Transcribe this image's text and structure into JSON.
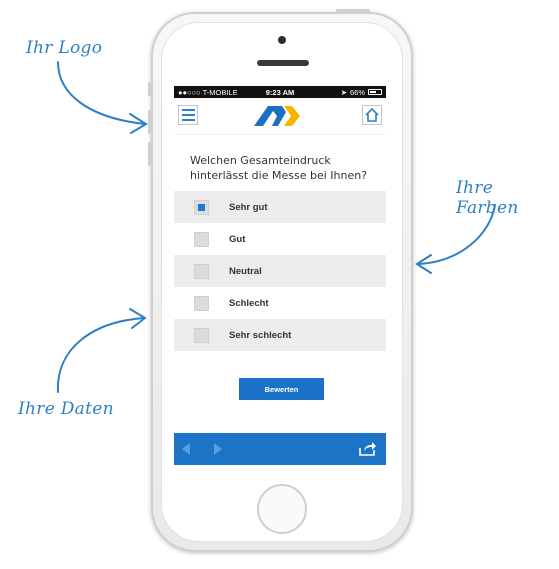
{
  "annotations": {
    "logo": "Ihr Logo",
    "colors": "Ihre Farben",
    "data": "Ihre Daten"
  },
  "statusbar": {
    "carrier": "●●○○○ T-MOBILE",
    "time": "9:23 AM",
    "battery": "66%"
  },
  "appbar": {
    "menu_icon": "hamburger-icon",
    "home_icon": "home-icon",
    "logo_colors": [
      "#1e6fc4",
      "#f2b600"
    ]
  },
  "survey": {
    "question": "Welchen Gesamteindruck hinterlässt die Messe bei Ihnen?",
    "options": [
      {
        "label": "Sehr gut",
        "checked": true
      },
      {
        "label": "Gut",
        "checked": false
      },
      {
        "label": "Neutral",
        "checked": false
      },
      {
        "label": "Schlecht",
        "checked": false
      },
      {
        "label": "Sehr schlecht",
        "checked": false
      }
    ],
    "submit_label": "Bewerten"
  },
  "bottombar": {
    "back_icon": "arrow-left-icon",
    "forward_icon": "arrow-right-icon",
    "share_icon": "share-icon"
  },
  "colors": {
    "accent": "#1c74c7",
    "annotation": "#2f7fc4"
  }
}
